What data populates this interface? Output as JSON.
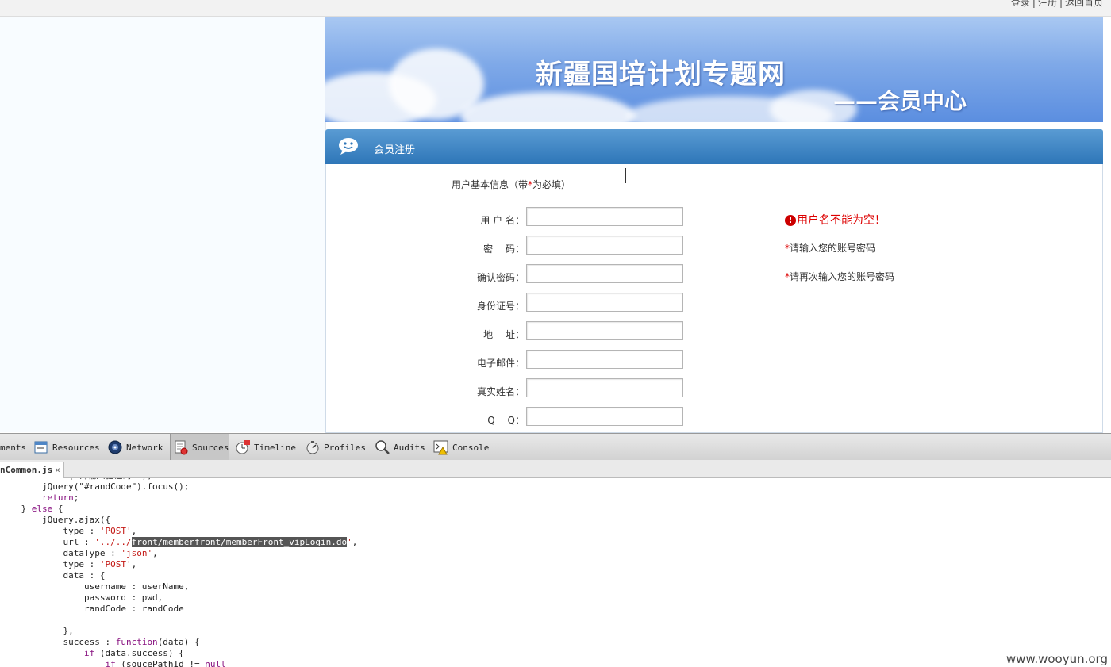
{
  "top_links": [
    "登录",
    "注册",
    "返回首页"
  ],
  "banner": {
    "title": "新疆国培计划专题网",
    "subtitle": "——会员中心"
  },
  "register_panel": {
    "header": "会员注册",
    "section_title_prefix": "用户基本信息（带",
    "section_title_star": "*",
    "section_title_suffix": "为必填）",
    "fields": [
      {
        "label": "用 户 名：",
        "value": ""
      },
      {
        "label": "密　 码：",
        "value": ""
      },
      {
        "label": "确认密码：",
        "value": ""
      },
      {
        "label": "身份证号：",
        "value": ""
      },
      {
        "label": "地　 址：",
        "value": ""
      },
      {
        "label": "电子邮件：",
        "value": ""
      },
      {
        "label": "真实姓名：",
        "value": ""
      },
      {
        "label": "Q　 Q：",
        "value": ""
      }
    ],
    "error_icon": "!",
    "error_message": "用户名不能为空！",
    "hints": [
      {
        "star": "*",
        "text": "请输入您的账号密码"
      },
      {
        "star": "*",
        "text": "请再次输入您的账号密码"
      }
    ]
  },
  "devtools": {
    "tabs": [
      {
        "label": "ments",
        "icon": "elements-icon"
      },
      {
        "label": "Resources",
        "icon": "resources-icon"
      },
      {
        "label": "Network",
        "icon": "network-icon"
      },
      {
        "label": "Sources",
        "icon": "sources-icon",
        "active": true
      },
      {
        "label": "Timeline",
        "icon": "timeline-icon"
      },
      {
        "label": "Profiles",
        "icon": "profiles-icon"
      },
      {
        "label": "Audits",
        "icon": "audits-icon"
      },
      {
        "label": "Console",
        "icon": "console-icon"
      }
    ],
    "open_file": "nCommon.js",
    "close_glyph": "×",
    "code_lines": [
      [
        [
          "",
          "        alert(\"请输入验证码!\");"
        ]
      ],
      [
        [
          "",
          "        jQuery(\"#randCode\").focus();"
        ]
      ],
      [
        [
          "kw",
          "        return"
        ],
        [
          "",
          ";"
        ]
      ],
      [
        [
          "",
          "    } "
        ],
        [
          "kw",
          "else"
        ],
        [
          "",
          " {"
        ]
      ],
      [
        [
          "",
          "        jQuery.ajax({"
        ]
      ],
      [
        [
          "",
          "            type : "
        ],
        [
          "str",
          "'POST'"
        ],
        [
          "",
          ","
        ]
      ],
      [
        [
          "",
          "            url : "
        ],
        [
          "str",
          "'../../"
        ],
        [
          "sel",
          "front/memberfront/memberFront_vipLogin.do"
        ],
        [
          "str",
          "'"
        ],
        [
          "",
          ","
        ]
      ],
      [
        [
          "",
          "            dataType : "
        ],
        [
          "str",
          "'json'"
        ],
        [
          "",
          ","
        ]
      ],
      [
        [
          "",
          "            type : "
        ],
        [
          "str",
          "'POST'"
        ],
        [
          "",
          ","
        ]
      ],
      [
        [
          "",
          "            data : {"
        ]
      ],
      [
        [
          "",
          "                username : userName,"
        ]
      ],
      [
        [
          "",
          "                password : pwd,"
        ]
      ],
      [
        [
          "",
          "                randCode : randCode"
        ]
      ],
      [
        [
          "",
          ""
        ]
      ],
      [
        [
          "",
          "            },"
        ]
      ],
      [
        [
          "",
          "            success : "
        ],
        [
          "kw",
          "function"
        ],
        [
          "",
          "(data) {"
        ]
      ],
      [
        [
          "",
          "                "
        ],
        [
          "kw",
          "if"
        ],
        [
          "",
          " (data.success) {"
        ]
      ],
      [
        [
          "",
          "                    "
        ],
        [
          "kw",
          "if"
        ],
        [
          "",
          " (soucePathId != "
        ],
        [
          "kw",
          "null"
        ]
      ]
    ]
  },
  "watermark": "www.wooyun.org"
}
